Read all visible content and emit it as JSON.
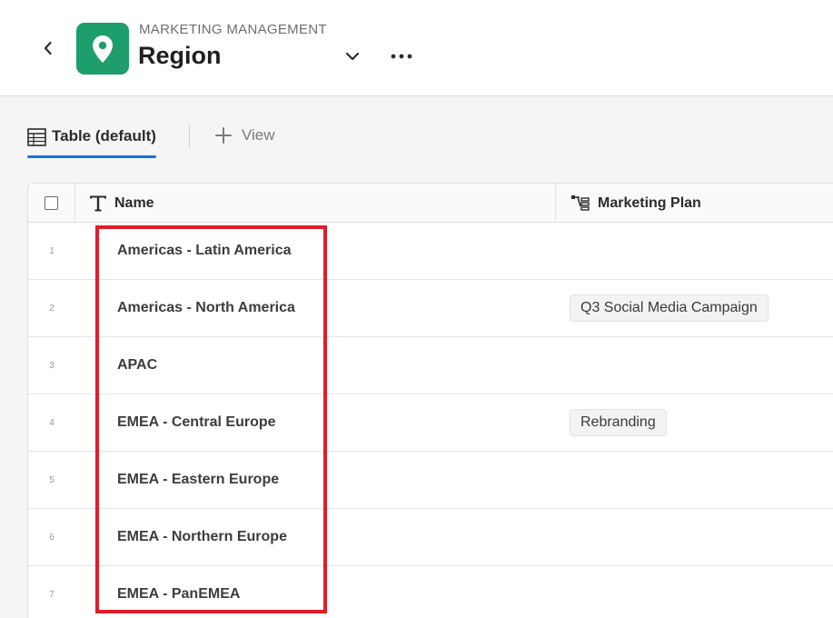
{
  "header": {
    "eyebrow": "MARKETING MANAGEMENT",
    "title": "Region",
    "app_icon": "map-pin-icon",
    "app_icon_color": "#1e9e6a"
  },
  "views": {
    "active_tab_label": "Table (default)",
    "add_view_label": "View",
    "accent_color": "#1473e6"
  },
  "table": {
    "columns": [
      {
        "label": "Name",
        "icon": "text-type-icon"
      },
      {
        "label": "Marketing Plan",
        "icon": "linked-record-icon"
      }
    ],
    "rows": [
      {
        "num": "1",
        "name": "Americas - Latin America",
        "plan": ""
      },
      {
        "num": "2",
        "name": "Americas - North America",
        "plan": "Q3 Social Media Campaign"
      },
      {
        "num": "3",
        "name": "APAC",
        "plan": ""
      },
      {
        "num": "4",
        "name": "EMEA - Central Europe",
        "plan": "Rebranding"
      },
      {
        "num": "5",
        "name": "EMEA - Eastern Europe",
        "plan": ""
      },
      {
        "num": "6",
        "name": "EMEA - Northern Europe",
        "plan": ""
      },
      {
        "num": "7",
        "name": "EMEA - PanEMEA",
        "plan": ""
      }
    ]
  },
  "annotation": {
    "highlight_color": "#e01e2b"
  }
}
